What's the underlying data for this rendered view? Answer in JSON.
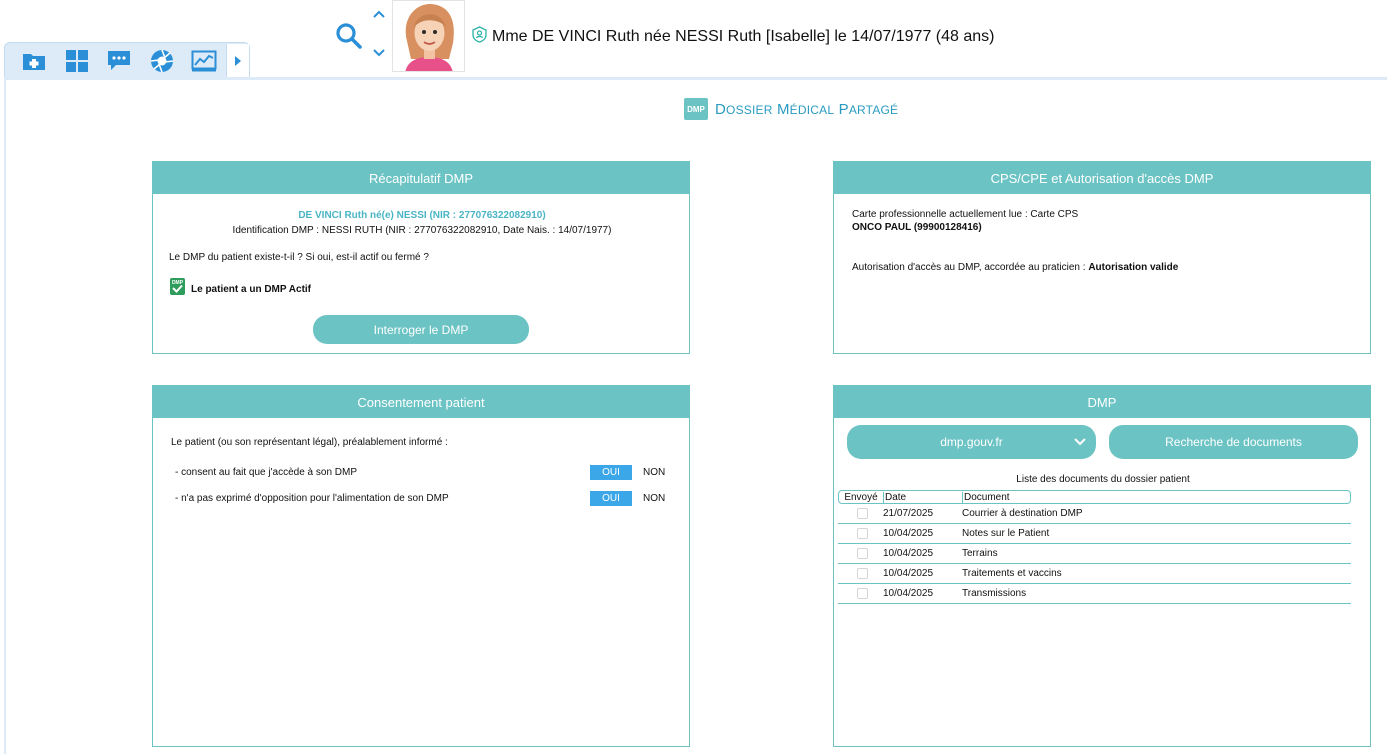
{
  "header": {
    "patient_line": "Mme DE VINCI Ruth née NESSI Ruth [Isabelle] le 14/07/1977 (48 ans)"
  },
  "toolbar": {
    "icons": [
      "folder-plus-icon",
      "grid-icon",
      "chat-icon",
      "aperture-icon",
      "chart-icon",
      "chevron-right-icon"
    ]
  },
  "title": {
    "logo": "DMP",
    "first_big": "D",
    "first_rest": "OSSIER",
    "second_big": "M",
    "second_rest": "ÉDICAL",
    "third_big": "P",
    "third_rest": "ARTAGÉ"
  },
  "recap": {
    "heading": "Récapitulatif DMP",
    "patient": "DE VINCI Ruth né(e) NESSI (NIR : 277076322082910)",
    "identification": "Identification DMP : NESSI RUTH (NIR : 277076322082910, Date Nais. : 14/07/1977)",
    "question": "Le DMP du patient existe-t-il ? Si oui, est-il actif ou fermé ?",
    "status": "Le patient a un DMP Actif",
    "button": "Interroger le DMP"
  },
  "cps": {
    "heading": "CPS/CPE et Autorisation d'accès  DMP",
    "card_label": "Carte professionnelle actuellement lue :  Carte CPS",
    "card_holder": "ONCO PAUL (99900128416)",
    "authorization_label": "Autorisation d'accès au DMP, accordée au praticien : ",
    "authorization_value": "Autorisation valide"
  },
  "consent": {
    "heading": "Consentement patient",
    "intro": "Le patient (ou son représentant légal), préalablement informé :",
    "row1": "- consent au fait que j'accède à son DMP",
    "row2": "- n'a pas exprimé d'opposition pour l'alimentation de son DMP",
    "yes": "OUI",
    "no": "NON"
  },
  "dmp": {
    "heading": "DMP",
    "select_value": "dmp.gouv.fr",
    "search_button": "Recherche de documents",
    "caption": "Liste des documents du dossier patient",
    "columns": [
      "Envoyé",
      "Date",
      "Document"
    ],
    "rows": [
      {
        "date": "21/07/2025",
        "document": "Courrier à destination DMP"
      },
      {
        "date": "10/04/2025",
        "document": "Notes sur le Patient"
      },
      {
        "date": "10/04/2025",
        "document": "Terrains"
      },
      {
        "date": "10/04/2025",
        "document": "Traitements et vaccins"
      },
      {
        "date": "10/04/2025",
        "document": "Transmissions"
      }
    ]
  },
  "colors": {
    "accent": "#6cc3c4",
    "toggle_on": "#3ba7e8",
    "toolbar_bg": "#dcebf7",
    "title_blue": "#2a9bc0"
  }
}
